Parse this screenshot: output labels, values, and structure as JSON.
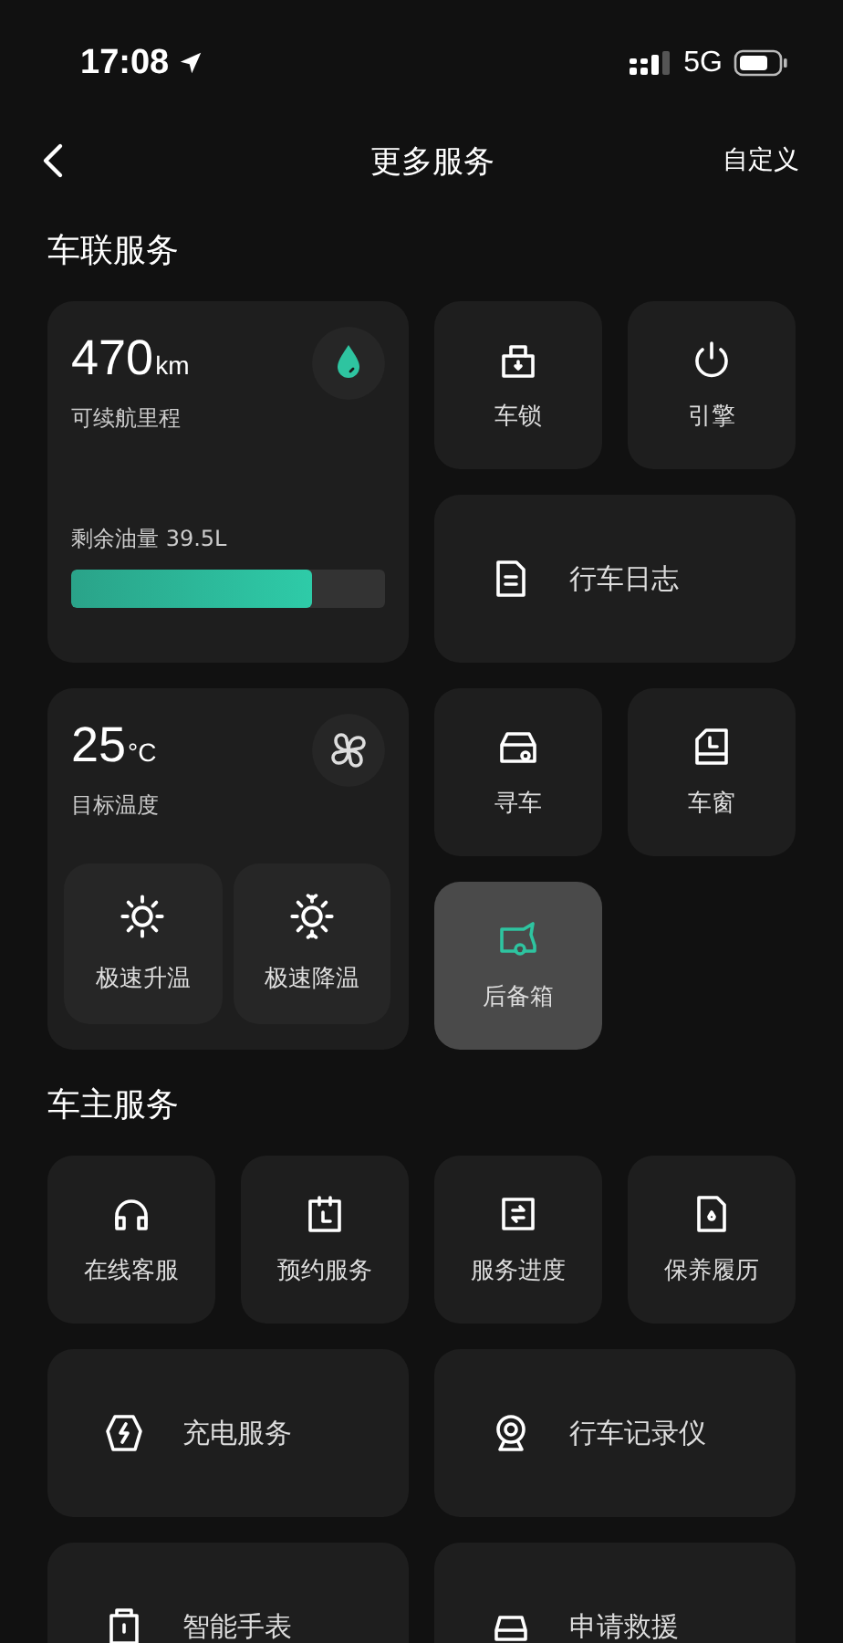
{
  "status_bar": {
    "time": "17:08",
    "network": "5G"
  },
  "nav": {
    "title": "更多服务",
    "action": "自定义"
  },
  "sections": [
    {
      "title": "车联服务",
      "items": [
        {
          "kind": "range",
          "value": "470",
          "unit": "km",
          "label": "可续航里程",
          "fuel": "剩余油量 39.5L",
          "level": 0.77
        },
        {
          "kind": "small",
          "label": "车锁",
          "selected": false
        },
        {
          "kind": "small",
          "label": "引擎",
          "selected": false
        },
        {
          "kind": "wide",
          "label": "行车日志",
          "selected": false
        },
        {
          "kind": "climate",
          "value": "25",
          "unit": "°C",
          "label": "目标温度",
          "buttons": [
            "极速升温",
            "极速降温"
          ]
        },
        {
          "kind": "small",
          "label": "寻车",
          "selected": false
        },
        {
          "kind": "small",
          "label": "车窗",
          "selected": false
        },
        {
          "kind": "small",
          "label": "后备箱",
          "selected": true
        }
      ]
    },
    {
      "title": "车主服务",
      "items": [
        {
          "kind": "small",
          "label": "在线客服",
          "selected": false
        },
        {
          "kind": "small",
          "label": "预约服务",
          "selected": false
        },
        {
          "kind": "small",
          "label": "服务进度",
          "selected": false
        },
        {
          "kind": "small",
          "label": "保养履历",
          "selected": false
        },
        {
          "kind": "wide",
          "label": "充电服务",
          "selected": false
        },
        {
          "kind": "wide",
          "label": "行车记录仪",
          "selected": false
        },
        {
          "kind": "wide",
          "label": "智能手表",
          "selected": false
        },
        {
          "kind": "wide",
          "label": "申请救援",
          "selected": false
        }
      ]
    }
  ]
}
